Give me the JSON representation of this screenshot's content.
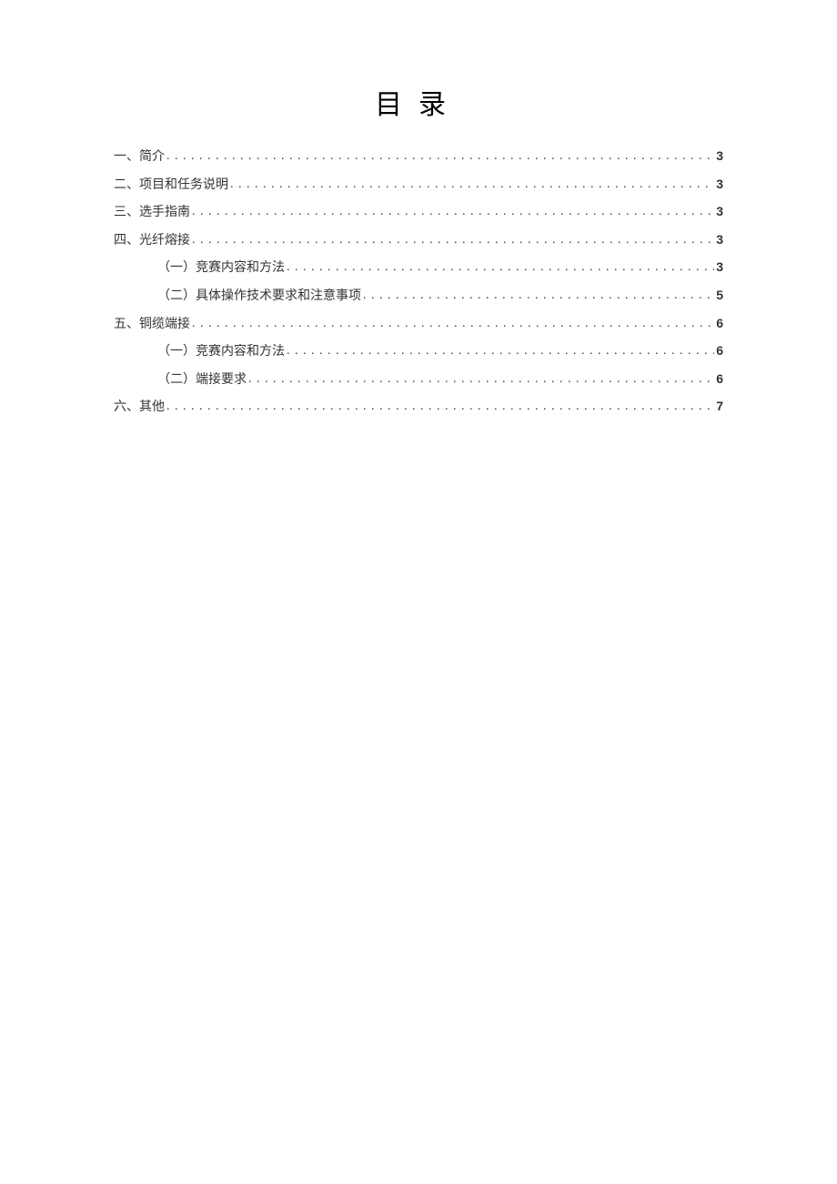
{
  "title": "目录",
  "toc": [
    {
      "label": "一、简介",
      "page": "3",
      "indent": false
    },
    {
      "label": "二、项目和任务说明",
      "page": "3",
      "indent": false
    },
    {
      "label": "三、选手指南",
      "page": "3",
      "indent": false
    },
    {
      "label": "四、光纤熔接",
      "page": "3",
      "indent": false
    },
    {
      "label": "（一）竞赛内容和方法",
      "page": "3",
      "indent": true
    },
    {
      "label": "（二）具体操作技术要求和注意事项",
      "page": "5",
      "indent": true
    },
    {
      "label": "五、铜缆端接",
      "page": "6",
      "indent": false
    },
    {
      "label": "（一）竞赛内容和方法",
      "page": "6",
      "indent": true
    },
    {
      "label": "（二）端接要求",
      "page": "6",
      "indent": true
    },
    {
      "label": "六、其他",
      "page": "7",
      "indent": false
    }
  ]
}
